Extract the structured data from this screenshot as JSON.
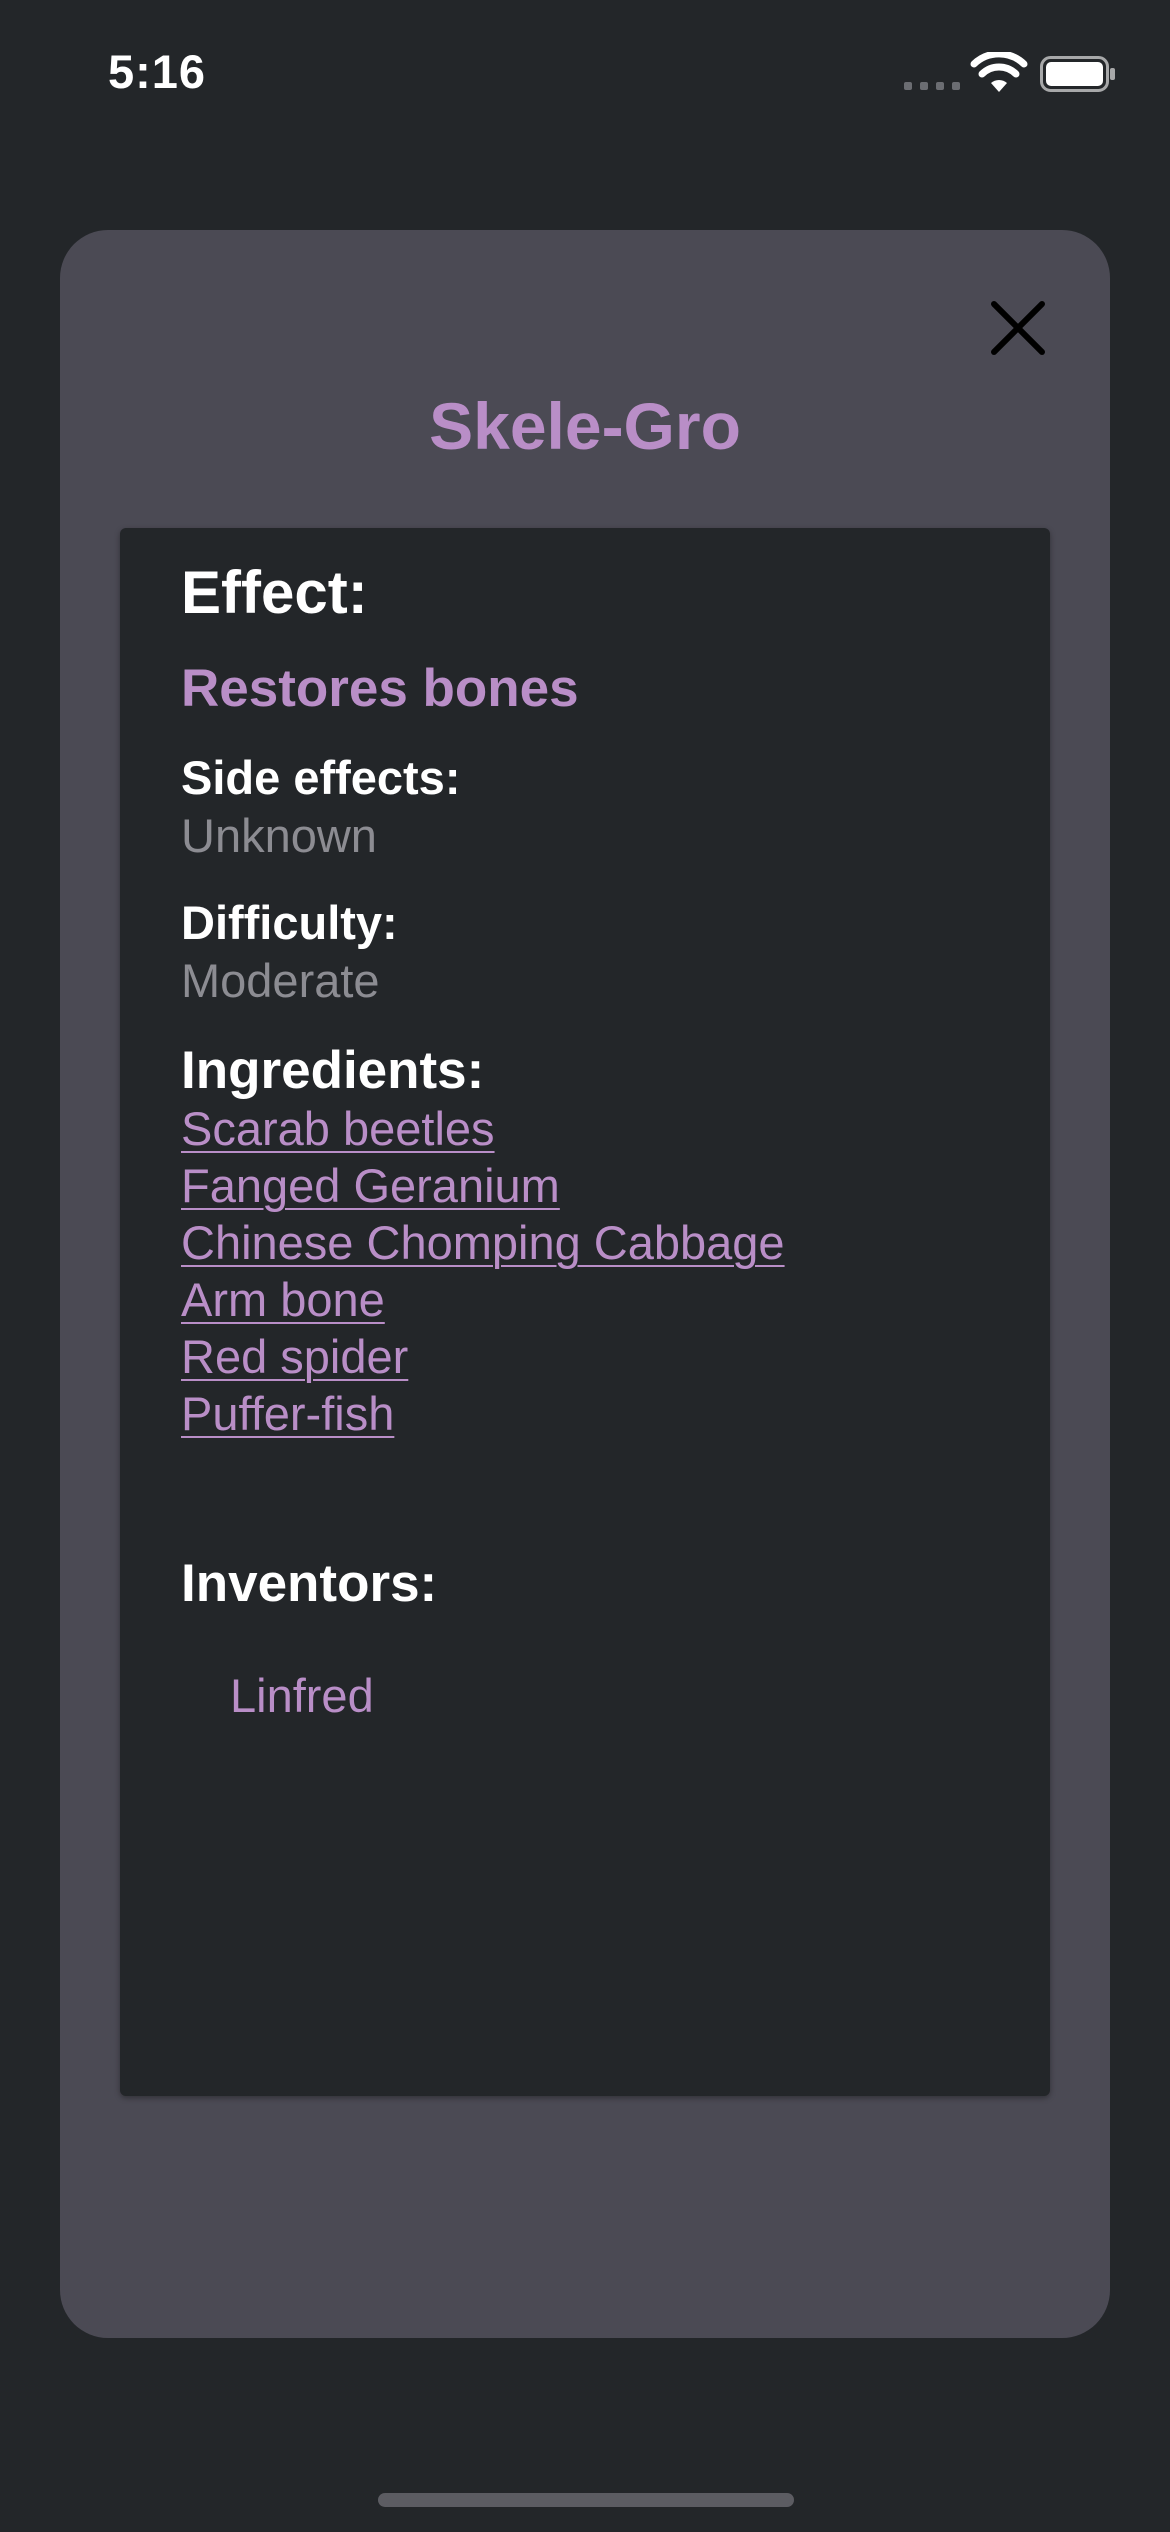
{
  "status_bar": {
    "time": "5:16",
    "icons": [
      "signal-icon",
      "wifi-icon",
      "battery-icon"
    ]
  },
  "modal": {
    "close_icon": "close-icon",
    "title": "Skele-Gro",
    "effect_heading": "Effect:",
    "effect_value": "Restores bones",
    "side_effects_label": "Side effects:",
    "side_effects_value": "Unknown",
    "difficulty_label": "Difficulty:",
    "difficulty_value": "Moderate",
    "ingredients_heading": "Ingredients:",
    "ingredients": [
      "Scarab beetles",
      "Fanged Geranium",
      "Chinese Chomping Cabbage",
      "Arm bone",
      "Red spider",
      "Puffer-fish"
    ],
    "inventors_heading": "Inventors:",
    "inventors": [
      "Linfred"
    ]
  },
  "colors": {
    "background": "#232629",
    "modal_background": "#4b4a54",
    "accent": "#b98ec7",
    "muted_text": "#8c8c92",
    "text": "#ffffff"
  }
}
